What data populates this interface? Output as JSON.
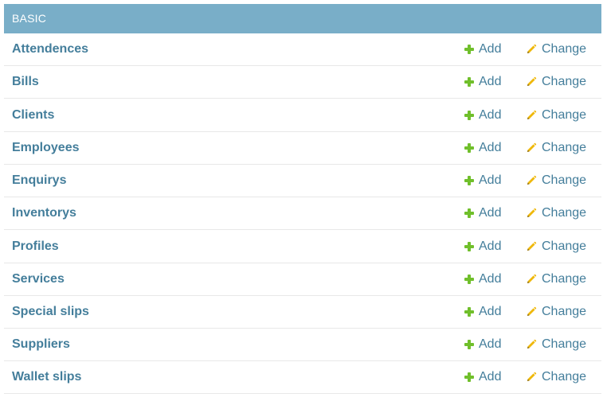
{
  "module": {
    "caption": "BASIC",
    "add_label": "Add",
    "change_label": "Change",
    "models": [
      {
        "name": "Attendences"
      },
      {
        "name": "Bills"
      },
      {
        "name": "Clients"
      },
      {
        "name": "Employees"
      },
      {
        "name": "Enquirys"
      },
      {
        "name": "Inventorys"
      },
      {
        "name": "Profiles"
      },
      {
        "name": "Services"
      },
      {
        "name": "Special slips"
      },
      {
        "name": "Suppliers"
      },
      {
        "name": "Wallet slips"
      }
    ]
  },
  "colors": {
    "caption_bg": "#79aec8",
    "link": "#447e9b",
    "add_icon": "#70bf2b",
    "change_icon": "#efb80b"
  },
  "icons": {
    "add": "plus-icon",
    "change": "pencil-icon"
  }
}
